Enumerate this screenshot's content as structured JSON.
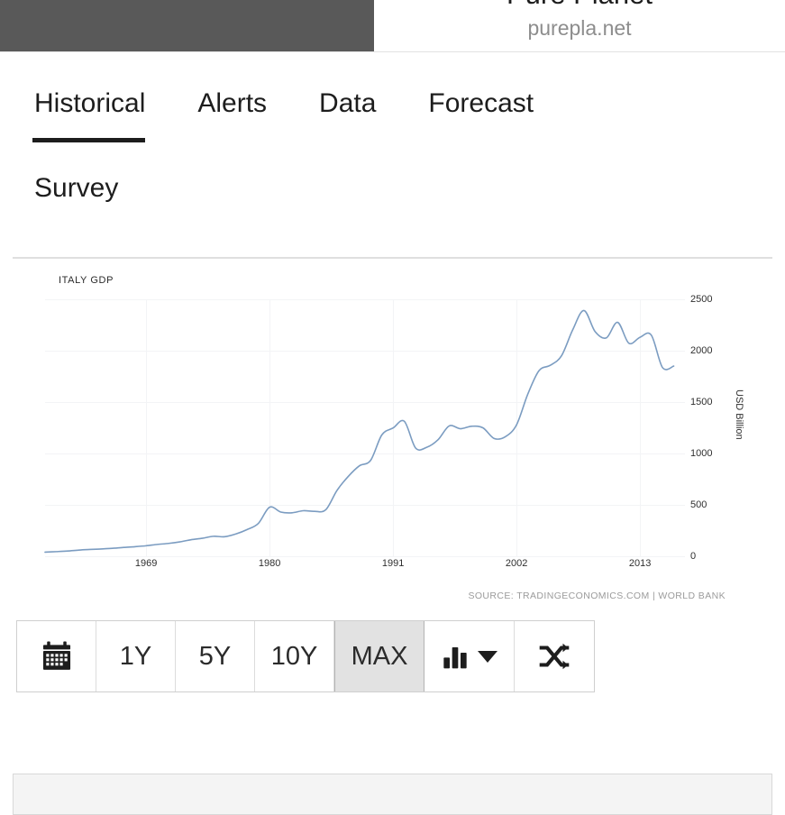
{
  "header": {
    "site_title": "Pure Planet",
    "site_domain": "purepla.net"
  },
  "tabs": [
    {
      "label": "Historical",
      "active": true
    },
    {
      "label": "Alerts",
      "active": false
    },
    {
      "label": "Data",
      "active": false
    },
    {
      "label": "Forecast",
      "active": false
    },
    {
      "label": "Survey",
      "active": false
    }
  ],
  "chart_card": {
    "source_text": "SOURCE: TRADINGECONOMICS.COM | WORLD BANK"
  },
  "toolbar": {
    "calendar_label": "calendar",
    "buttons": [
      "1Y",
      "5Y",
      "10Y",
      "MAX"
    ],
    "selected": "MAX",
    "chart_type_label": "chart-type",
    "compare_label": "compare"
  },
  "colors": {
    "line": "#7b9cc1",
    "grid": "#f3f4f6",
    "header_block": "#595959",
    "active_tab_underline": "#1d1d1d",
    "selected_button_bg": "#e2e2e2"
  },
  "chart_data": {
    "type": "line",
    "title": "ITALY GDP",
    "xlabel": "",
    "ylabel": "USD Billion",
    "ylim": [
      0,
      2500
    ],
    "xlim": [
      1960,
      2017
    ],
    "grid": true,
    "legend": null,
    "yticks": [
      0,
      500,
      1000,
      1500,
      2000,
      2500
    ],
    "xticks": [
      1969,
      1980,
      1991,
      2002,
      2013
    ],
    "series": [
      {
        "name": "Italy GDP",
        "x": [
          1960,
          1961,
          1962,
          1963,
          1964,
          1965,
          1966,
          1967,
          1968,
          1969,
          1970,
          1971,
          1972,
          1973,
          1974,
          1975,
          1976,
          1977,
          1978,
          1979,
          1980,
          1981,
          1982,
          1983,
          1984,
          1985,
          1986,
          1987,
          1988,
          1989,
          1990,
          1991,
          1992,
          1993,
          1994,
          1995,
          1996,
          1997,
          1998,
          1999,
          2000,
          2001,
          2002,
          2003,
          2004,
          2005,
          2006,
          2007,
          2008,
          2009,
          2010,
          2011,
          2012,
          2013,
          2014,
          2015,
          2016
        ],
        "values": [
          40,
          45,
          51,
          60,
          66,
          71,
          77,
          86,
          93,
          102,
          115,
          125,
          140,
          161,
          175,
          194,
          190,
          217,
          260,
          320,
          477,
          430,
          423,
          443,
          437,
          452,
          640,
          776,
          880,
          933,
          1181,
          1248,
          1313,
          1054,
          1060,
          1133,
          1268,
          1241,
          1265,
          1250,
          1146,
          1163,
          1279,
          1577,
          1806,
          1858,
          1950,
          2203,
          2391,
          2185,
          2125,
          2276,
          2073,
          2131,
          2152,
          1836,
          1850
        ]
      }
    ]
  }
}
